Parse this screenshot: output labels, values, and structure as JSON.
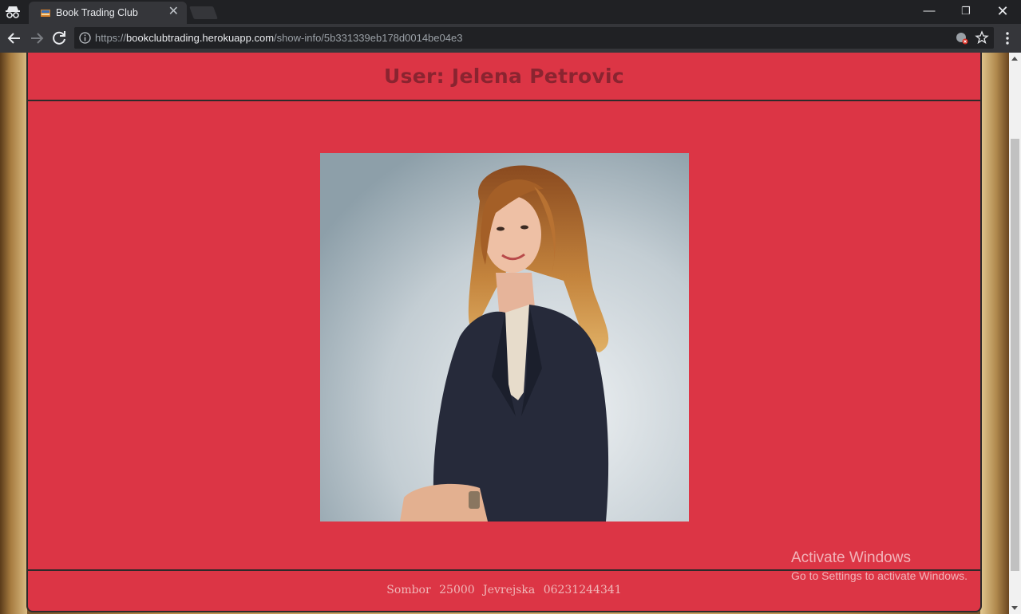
{
  "browser": {
    "tab_title": "Book Trading Club",
    "tab_close": "✕",
    "url_scheme": "https://",
    "url_host": "bookclubtrading.herokuapp.com",
    "url_path": "/show-info/5b331339eb178d0014be04e3",
    "window_controls": {
      "minimize": "—",
      "maximize": "❐",
      "close": "✕"
    }
  },
  "page": {
    "title": "User: Jelena Petrovic",
    "footer": "Sombor 25000 Jevrejska 06231244341"
  },
  "watermark": {
    "title": "Activate Windows",
    "subtitle": "Go to Settings to activate Windows."
  },
  "colors": {
    "card_bg": "#dc3545",
    "title": "#8a2430",
    "border": "#2e2a2a"
  }
}
